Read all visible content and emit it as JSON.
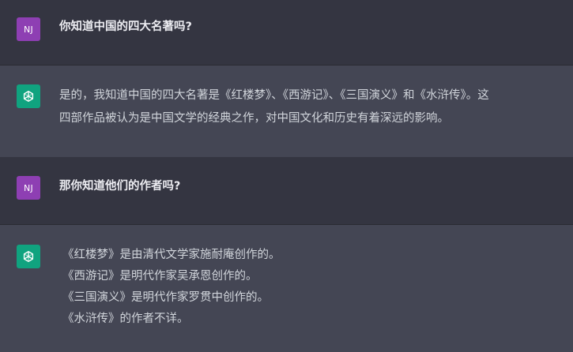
{
  "conversation": {
    "user_initials": "NJ",
    "q1": "你知道中国的四大名著吗?",
    "a1": {
      "line1": "是的，我知道中国的四大名著是《红楼梦》、《西游记》、《三国演义》和《水浒传》。这",
      "line2": "四部作品被认为是中国文学的经典之作，对中国文化和历史有着深远的影响。"
    },
    "q2": "那你知道他们的作者吗?",
    "a2": {
      "line1": "《红楼梦》是由清代文学家施耐庵创作的。",
      "line2": "《西游记》是明代作家吴承恩创作的。",
      "line3": "《三国演义》是明代作家罗贯中创作的。",
      "line4": "《水浒传》的作者不详。"
    }
  },
  "icons": {
    "user_avatar": "user-avatar",
    "assistant_avatar": "openai-logo-icon"
  },
  "colors": {
    "user_row_bg": "#343541",
    "assistant_row_bg": "#444654",
    "user_avatar_bg": "#8e3fb3",
    "assistant_avatar_bg": "#10a37f",
    "text": "#ececf1"
  }
}
